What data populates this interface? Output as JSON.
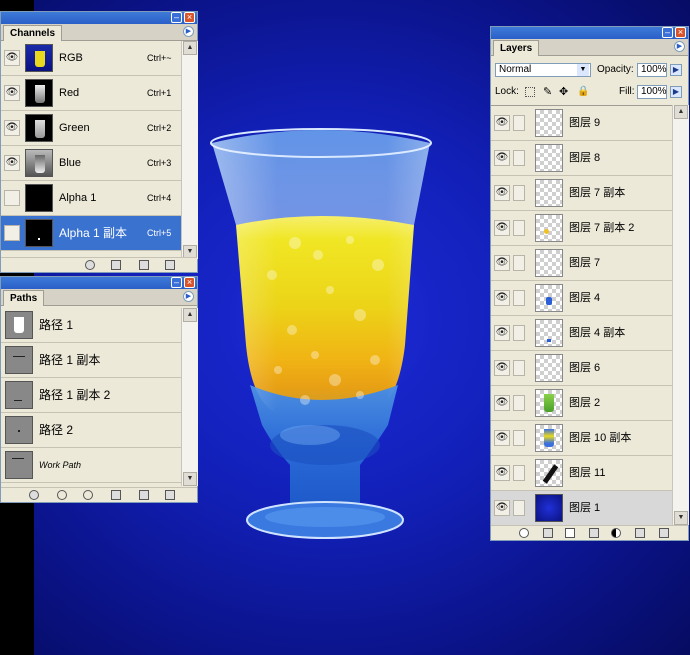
{
  "canvas": {
    "description_icon": "glass-of-layered-drink"
  },
  "channels": {
    "title": "Channels",
    "items": [
      {
        "label": "RGB",
        "shortcut": "Ctrl+~",
        "visible": true
      },
      {
        "label": "Red",
        "shortcut": "Ctrl+1",
        "visible": true
      },
      {
        "label": "Green",
        "shortcut": "Ctrl+2",
        "visible": true
      },
      {
        "label": "Blue",
        "shortcut": "Ctrl+3",
        "visible": true
      },
      {
        "label": "Alpha 1",
        "shortcut": "Ctrl+4",
        "visible": false
      },
      {
        "label": "Alpha 1 副本",
        "shortcut": "Ctrl+5",
        "visible": false,
        "selected": true
      }
    ]
  },
  "paths": {
    "title": "Paths",
    "items": [
      {
        "label": "路径 1"
      },
      {
        "label": "路径 1 副本"
      },
      {
        "label": "路径 1 副本 2"
      },
      {
        "label": "路径 2"
      },
      {
        "label": "Work Path"
      }
    ]
  },
  "layers": {
    "title": "Layers",
    "blend_mode": "Normal",
    "opacity_label": "Opacity:",
    "opacity_value": "100%",
    "lock_label": "Lock:",
    "fill_label": "Fill:",
    "fill_value": "100%",
    "items": [
      {
        "label": "图层 9"
      },
      {
        "label": "图层 8"
      },
      {
        "label": "图层 7 副本"
      },
      {
        "label": "图层 7 副本 2"
      },
      {
        "label": "图层 7"
      },
      {
        "label": "图层 4"
      },
      {
        "label": "图层 4 副本"
      },
      {
        "label": "图层 6"
      },
      {
        "label": "图层 2"
      },
      {
        "label": "图层 10 副本"
      },
      {
        "label": "图层 11"
      },
      {
        "label": "图层 1",
        "selected": true
      }
    ]
  },
  "colors": {
    "accent": "#3a72d0",
    "panel_bg": "#ece9d8",
    "canvas_blue": "#1220b8",
    "drink_yellow": "#f2e21a",
    "drink_orange": "#f0a010"
  }
}
